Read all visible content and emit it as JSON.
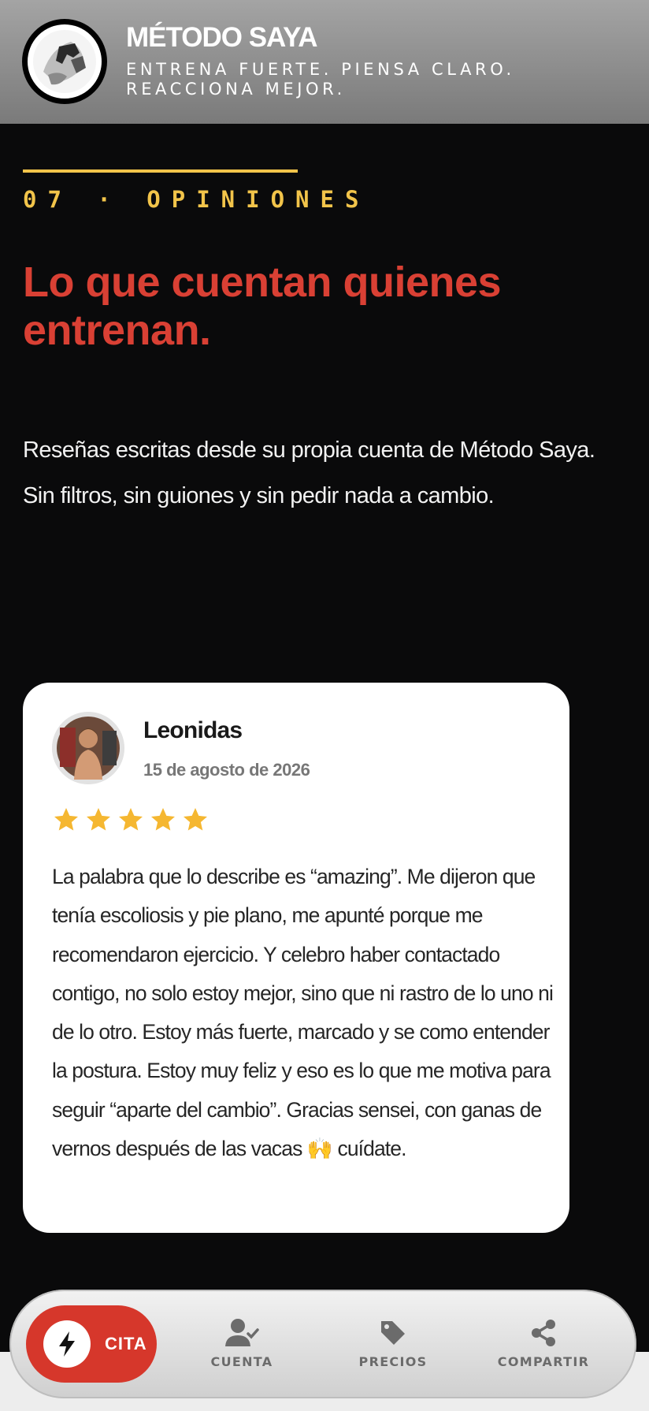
{
  "header": {
    "title": "MÉTODO SAYA",
    "tagline": "ENTRENA FUERTE. PIENSA CLARO. REACCIONA MEJOR."
  },
  "section": {
    "kicker": "07 · OPINIONES",
    "headline": "Lo que cuentan quienes entrenan.",
    "intro": "Reseñas escritas desde su propia cuenta de Método Saya. Sin filtros, sin guiones y sin pedir nada a cambio."
  },
  "review": {
    "name": "Leonidas",
    "date": "15 de agosto de 2026",
    "rating": 5,
    "text": "La palabra que lo describe es “amazing”. Me dijeron que tenía escoliosis y pie plano, me apunté porque me recomendaron ejercicio. Y celebro haber contactado contigo, no solo estoy mejor, sino que ni rastro de lo uno ni de lo otro. Estoy más fuerte, marcado y se como entender la postura. Estoy muy feliz y eso es lo que me motiva para seguir “aparte del cambio”. Gracias sensei, con ganas de vernos después de las vacas 🙌 cuídate."
  },
  "nav": {
    "cita": "CITA",
    "cuenta": "CUENTA",
    "precios": "PRECIOS",
    "compartir": "COMPARTIR"
  },
  "colors": {
    "accent_yellow": "#f2c44a",
    "accent_red": "#d94034",
    "background": "#0a0a0b",
    "star": "#f5b731"
  },
  "icons": [
    "bolt-icon",
    "user-check-icon",
    "tag-icon",
    "share-icon",
    "star-icon"
  ]
}
